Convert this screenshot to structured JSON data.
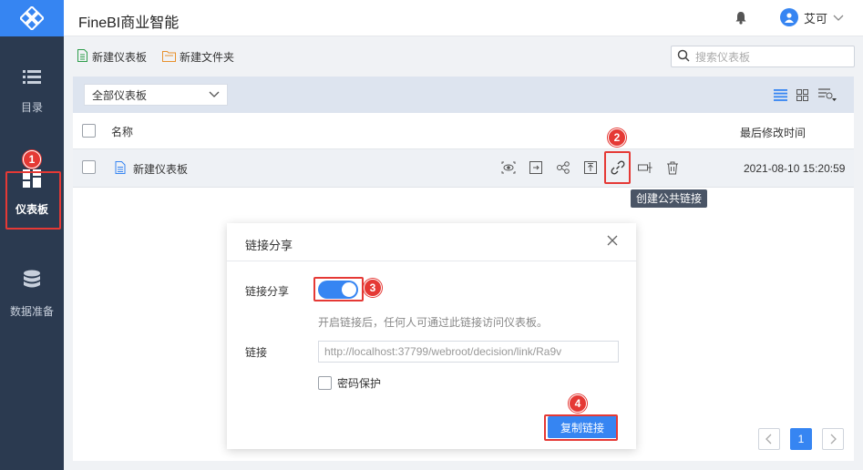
{
  "app": {
    "title": "FineBI商业智能"
  },
  "header": {
    "user_name": "艾可"
  },
  "sidebar": {
    "items": [
      {
        "label": "目录"
      },
      {
        "label": "仪表板"
      },
      {
        "label": "数据准备"
      }
    ]
  },
  "toolbar": {
    "new_dashboard": "新建仪表板",
    "new_folder": "新建文件夹",
    "search_placeholder": "搜索仪表板"
  },
  "filter": {
    "selected": "全部仪表板"
  },
  "table": {
    "col_name": "名称",
    "col_time": "最后修改时间",
    "rows": [
      {
        "name": "新建仪表板",
        "time": "2021-08-10 15:20:59"
      }
    ]
  },
  "tooltip": "创建公共链接",
  "dialog": {
    "title": "链接分享",
    "share_label": "链接分享",
    "share_enabled": true,
    "hint": "开启链接后，任何人可通过此链接访问仪表板。",
    "link_label": "链接",
    "link_value": "http://localhost:37799/webroot/decision/link/Ra9v",
    "password_label": "密码保护",
    "copy_button": "复制链接"
  },
  "pagination": {
    "current": "1"
  },
  "callouts": [
    "1",
    "2",
    "3",
    "4"
  ],
  "colors": {
    "accent": "#3685f2",
    "sidebar": "#2b3a50",
    "callout": "#e53935"
  }
}
